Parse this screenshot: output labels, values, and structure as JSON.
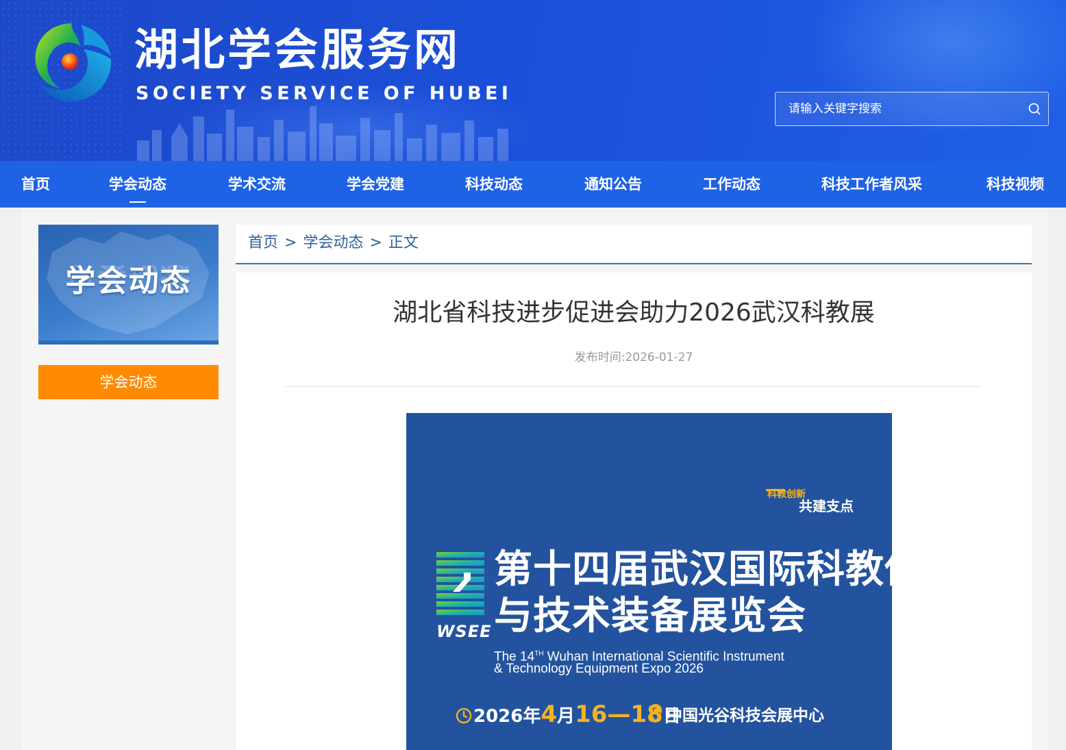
{
  "header": {
    "title": "湖北学会服务网",
    "subtitle": "SOCIETY SERVICE OF HUBEI",
    "search": {
      "placeholder": "请输入关键字搜索"
    }
  },
  "nav": {
    "items": [
      "首页",
      "学会动态",
      "学术交流",
      "学会党建",
      "科技动态",
      "通知公告",
      "工作动态",
      "科技工作者风采",
      "科技视频"
    ],
    "active": "学会动态"
  },
  "sidebar": {
    "banner_title": "学会动态",
    "menu": [
      "学会动态"
    ],
    "menu_color": "#ff8a00"
  },
  "breadcrumb": {
    "items": [
      "首页",
      "学会动态",
      "正文"
    ],
    "separator": ">"
  },
  "article": {
    "title": "湖北省科技进步促进会助力2026武汉科教展",
    "publish_label": "发布时间:",
    "publish_date": "2026-01-27"
  },
  "poster": {
    "slogan_line1": "科教创新",
    "slogan_line2": "共建支点",
    "logo_text": "WSEE",
    "title_line1": "第十四届武汉国际科教仪器",
    "title_line2": "与技术装备展览会",
    "en_line1_prefix": "The 14",
    "en_line1_sup": "TH",
    "en_line1_rest": " Wuhan International Scientific Instrument",
    "en_line2": "& Technology Equipment Expo 2026",
    "date_prefix": "2026年",
    "date_month": "4",
    "date_mid": "月",
    "date_days": "16—18",
    "date_suffix": "日",
    "venue": "中国光谷科技会展中心",
    "highlight_color": "#f5b21f",
    "background_color": "#23539e"
  },
  "colors": {
    "header_blue": "#1b4ed8",
    "nav_blue": "#1e62e6",
    "breadcrumb_line": "#2f6fb5"
  }
}
